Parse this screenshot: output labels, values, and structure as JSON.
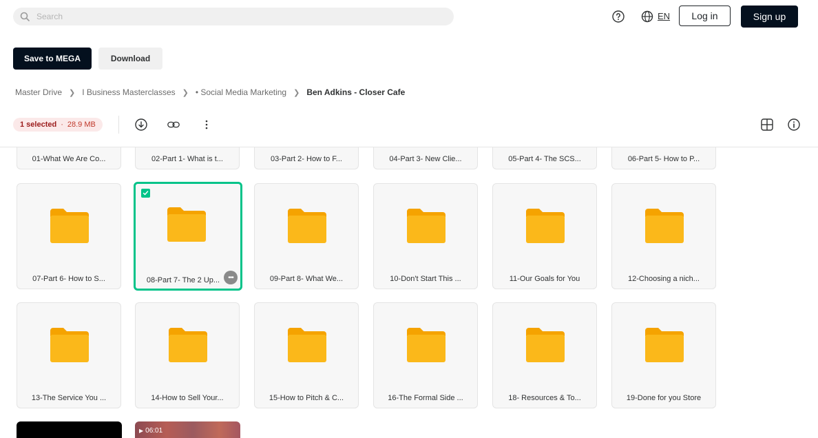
{
  "header": {
    "search_placeholder": "Search",
    "language": "EN",
    "login_label": "Log in",
    "signup_label": "Sign up"
  },
  "actions": {
    "save_label": "Save to MEGA",
    "download_label": "Download"
  },
  "breadcrumb": {
    "items": [
      "Master Drive",
      "I Business Masterclasses",
      "• Social Media Marketing"
    ],
    "current": "Ben Adkins - Closer Cafe"
  },
  "selection": {
    "count_label": "1 selected",
    "size": "28.9 MB"
  },
  "folders": {
    "row0": [
      "01-What We Are Co...",
      "02-Part 1- What is t...",
      "03-Part 2- How to F...",
      "04-Part 3- New Clie...",
      "05-Part 4- The SCS...",
      "06-Part 5- How to P..."
    ],
    "row1": [
      "07-Part 6- How to S...",
      "08-Part 7- The 2 Up...",
      "09-Part 8- What We...",
      "10-Don't Start This ...",
      "11-Our Goals for You",
      "12-Choosing a nich..."
    ],
    "row2": [
      "13-The Service You ...",
      "14-How to Sell Your...",
      "15-How to Pitch & C...",
      "16-The Formal Side ...",
      "18- Resources & To...",
      "19-Done for you Store"
    ]
  },
  "video": {
    "duration": "06:01"
  },
  "colors": {
    "accent": "#00c389",
    "folder": "#f9b416",
    "primary_button": "#04101e"
  }
}
